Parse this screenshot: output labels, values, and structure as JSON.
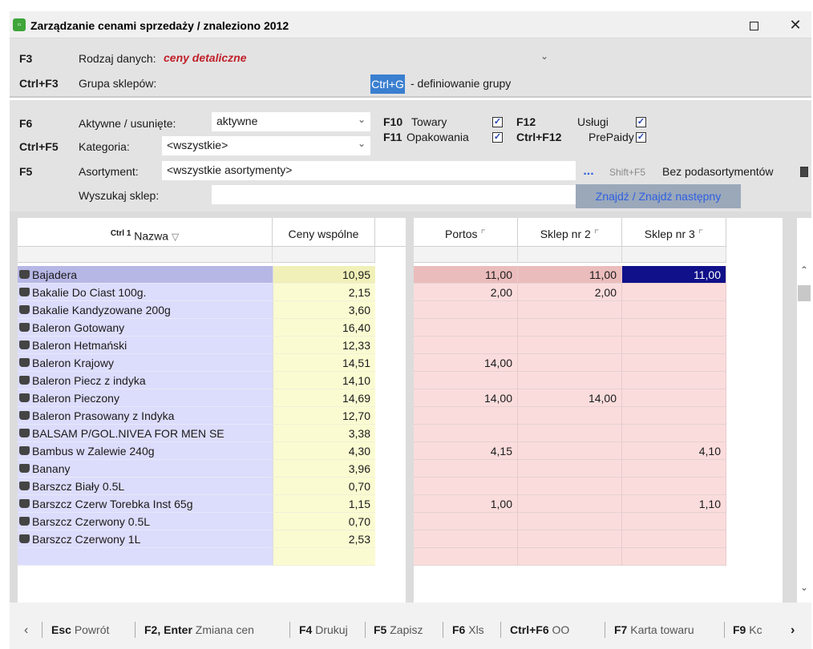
{
  "window": {
    "title": "Zarządzanie cenami sprzedaży / znaleziono 2012",
    "maximize_icon": "maximize-icon",
    "close_label": "✕"
  },
  "filters": {
    "data_type": {
      "key": "F3",
      "label": "Rodzaj danych:",
      "value": "ceny detaliczne",
      "value_color": "#c0202a"
    },
    "store_group": {
      "key": "Ctrl+F3",
      "label": "Grupa sklepów:",
      "button": "Ctrl+G",
      "hint": "- definiowanie grupy"
    },
    "active": {
      "key": "F6",
      "label": "Aktywne / usunięte:",
      "value": "aktywne"
    },
    "category": {
      "key": "Ctrl+F5",
      "label": "Kategoria:",
      "value": "<wszystkie>"
    },
    "assortment": {
      "key": "F5",
      "label": "Asortyment:",
      "value": "<wszystkie asortymenty>",
      "dots": "...",
      "shift_key": "Shift+F5",
      "sub_label": "Bez podasortymentów"
    },
    "search": {
      "label": "Wyszukaj sklep:",
      "value": "",
      "find_button": "Znajdź / Znajdź następny"
    },
    "types": [
      {
        "key": "F10",
        "label": "Towary",
        "checked": true
      },
      {
        "key": "F11",
        "label": "Opakowania",
        "checked": true
      },
      {
        "key": "F12",
        "label": "Usługi",
        "checked": true
      },
      {
        "key": "Ctrl+F12",
        "label": "PrePaidy",
        "checked": true
      }
    ]
  },
  "left_columns": {
    "name_prefix": "Ctrl 1",
    "name": "Nazwa",
    "common_price": "Ceny wspólne"
  },
  "store_columns": [
    "Portos",
    "Sklep nr 2",
    "Sklep nr 3"
  ],
  "rows": [
    {
      "name": "Bajadera",
      "common": "10,95",
      "stores": [
        "11,00",
        "11,00",
        "11,00"
      ],
      "selected": true
    },
    {
      "name": "Bakalie Do Ciast 100g.",
      "common": "2,15",
      "stores": [
        "2,00",
        "2,00",
        ""
      ]
    },
    {
      "name": "Bakalie Kandyzowane 200g",
      "common": "3,60",
      "stores": [
        "",
        "",
        ""
      ]
    },
    {
      "name": "Baleron Gotowany",
      "common": "16,40",
      "stores": [
        "",
        "",
        ""
      ]
    },
    {
      "name": "Baleron Hetmański",
      "common": "12,33",
      "stores": [
        "",
        "",
        ""
      ]
    },
    {
      "name": "Baleron Krajowy",
      "common": "14,51",
      "stores": [
        "14,00",
        "",
        ""
      ]
    },
    {
      "name": "Baleron Piecz z indyka",
      "common": "14,10",
      "stores": [
        "",
        "",
        ""
      ]
    },
    {
      "name": "Baleron Pieczony",
      "common": "14,69",
      "stores": [
        "14,00",
        "14,00",
        ""
      ]
    },
    {
      "name": "Baleron Prasowany z Indyka",
      "common": "12,70",
      "stores": [
        "",
        "",
        ""
      ]
    },
    {
      "name": "BALSAM P/GOL.NIVEA FOR MEN SE",
      "common": "3,38",
      "stores": [
        "",
        "",
        ""
      ]
    },
    {
      "name": "Bambus w Zalewie 240g",
      "common": "4,30",
      "stores": [
        "4,15",
        "",
        "4,10"
      ]
    },
    {
      "name": "Banany",
      "common": "3,96",
      "stores": [
        "",
        "",
        ""
      ]
    },
    {
      "name": "Barszcz Biały 0.5L",
      "common": "0,70",
      "stores": [
        "",
        "",
        ""
      ]
    },
    {
      "name": "Barszcz Czerw Torebka Inst 65g",
      "common": "1,15",
      "stores": [
        "1,00",
        "",
        "1,10"
      ]
    },
    {
      "name": "Barszcz Czerwony 0.5L",
      "common": "0,70",
      "stores": [
        "",
        "",
        ""
      ]
    },
    {
      "name": "Barszcz Czerwony 1L",
      "common": "2,53",
      "stores": [
        "",
        "",
        ""
      ]
    }
  ],
  "statusbar": [
    {
      "key": "Esc",
      "label": "Powrót"
    },
    {
      "key": "F2, Enter",
      "label": "Zmiana cen"
    },
    {
      "key": "F4",
      "label": "Drukuj"
    },
    {
      "key": "F5",
      "label": "Zapisz"
    },
    {
      "key": "F6",
      "label": "Xls"
    },
    {
      "key": "Ctrl+F6",
      "label": "OO"
    },
    {
      "key": "F7",
      "label": "Karta towaru"
    },
    {
      "key": "F9",
      "label": "Kc"
    }
  ],
  "colors": {
    "name_bg": "#dcdcfc",
    "common_bg": "#fbfbd2",
    "store_bg": "#fbdcdc",
    "focus_bg": "#10108a",
    "accent_blue": "#2f5fe0"
  }
}
